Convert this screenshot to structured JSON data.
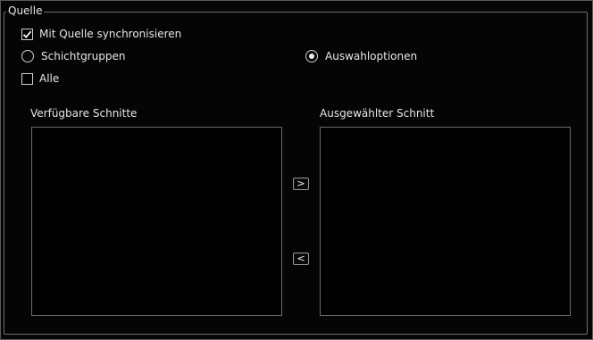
{
  "group": {
    "title": "Quelle"
  },
  "options": {
    "sync_label": "Mit Quelle synchronisieren",
    "sync_checked": true,
    "radio_layer_groups_label": "Schichtgruppen",
    "radio_selection_options_label": "Auswahloptionen",
    "selected_radio": "Auswahloptionen",
    "all_label": "Alle",
    "all_checked": false
  },
  "lists": {
    "available_label": "Verfügbare Schnitte",
    "available_items": [],
    "selected_label": "Ausgewählter Schnitt",
    "selected_items": []
  },
  "buttons": {
    "add_label": ">",
    "remove_label": "<"
  },
  "colors": {
    "background": "#000000",
    "border": "#6b6b6b",
    "text": "#e6e6e6"
  }
}
